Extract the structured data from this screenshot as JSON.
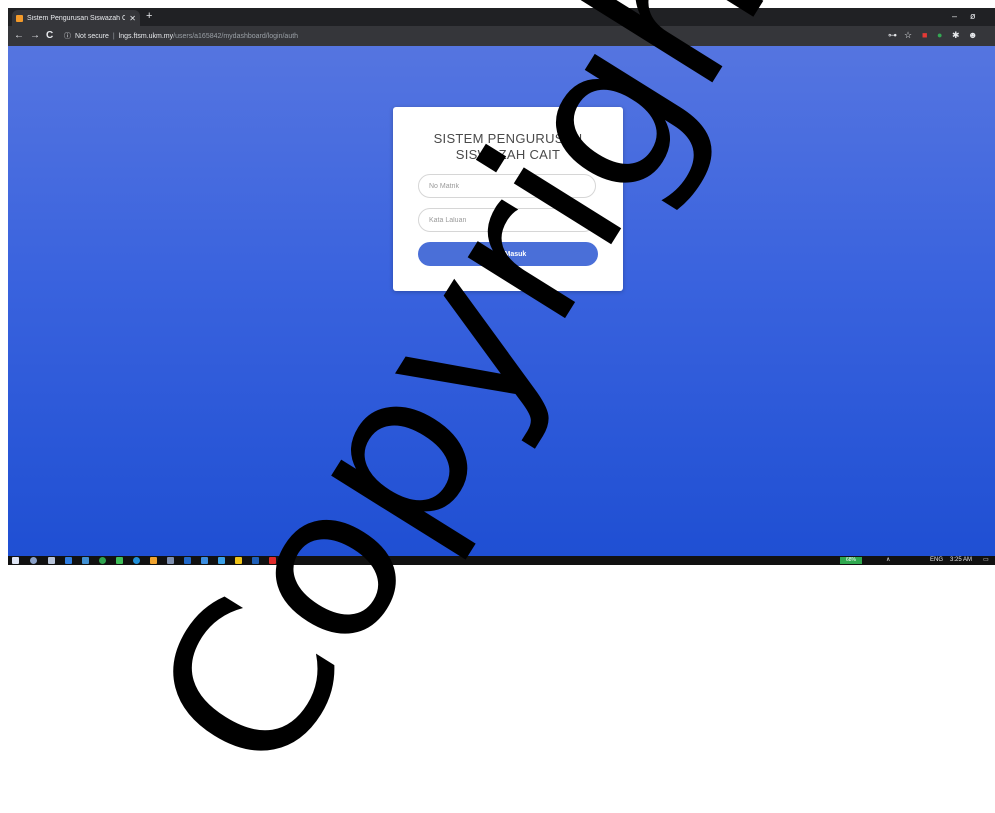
{
  "browser": {
    "tab_title": "Sistem Pengurusan Siswazah CAI",
    "new_tab": "+",
    "nav": {
      "back": "←",
      "forward": "→",
      "reload": "C"
    },
    "url_security": "Not secure",
    "url_host": "lngs.ftsm.ukm.my",
    "url_path": "/users/a165842/mydashboard/login/auth",
    "window": {
      "minimize": "–",
      "maximize": "ø"
    }
  },
  "login": {
    "title_line1": "SISTEM PENGURUSAN",
    "title_line2": "SISWAZAH CAIT",
    "username_placeholder": "No Matrik",
    "password_placeholder": "Kata Laluan",
    "submit_label": "Log Masuk"
  },
  "taskbar": {
    "battery": "68%",
    "language": "ENG",
    "time": "3:25 AM"
  },
  "watermark": "Copyright",
  "colors": {
    "page_top": "#5575e0",
    "page_bottom": "#1f4fd3",
    "button": "#4a6fd8"
  }
}
